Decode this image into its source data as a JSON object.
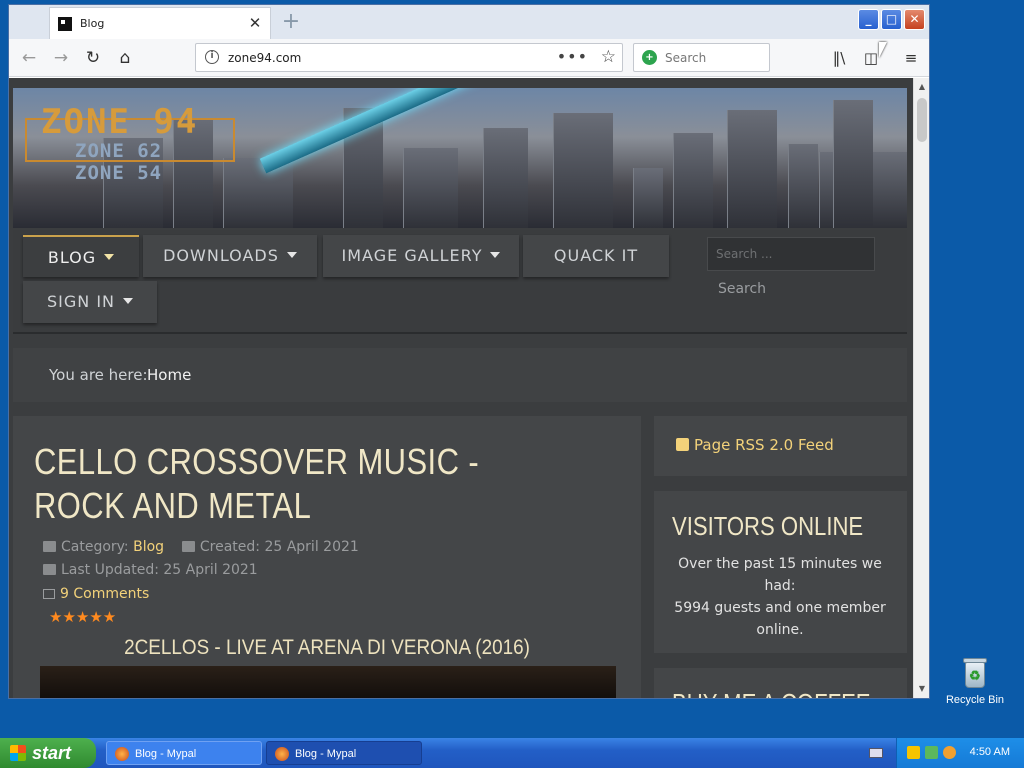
{
  "desktop": {
    "recycle_bin_label": "Recycle Bin"
  },
  "browser": {
    "tab_title": "Blog",
    "url": "zone94.com",
    "search_placeholder": "Search"
  },
  "site": {
    "logo_main": "ZONE 94",
    "logo_sub1": "ZONE 62",
    "logo_sub2": "ZONE 54",
    "menu": [
      {
        "label": "BLOG"
      },
      {
        "label": "DOWNLOADS"
      },
      {
        "label": "IMAGE GALLERY"
      },
      {
        "label": "QUACK IT"
      },
      {
        "label": "SIGN IN"
      }
    ],
    "search_placeholder": "Search ...",
    "search_button": "Search",
    "breadcrumb_label": "You are here:",
    "breadcrumb_home": "Home"
  },
  "article": {
    "title": "CELLO CROSSOVER MUSIC - ROCK AND METAL",
    "category_label": "Category:",
    "category_value": "Blog",
    "created": "Created: 25 April 2021",
    "updated": "Last Updated: 25 April 2021",
    "comments": "9 Comments",
    "rating_stars": 5,
    "subheading": "2CELLOS - LIVE AT ARENA DI VERONA (2016)"
  },
  "sidebar": {
    "rss": "Page RSS 2.0 Feed",
    "visitors_title": "VISITORS ONLINE",
    "visitors_text_1": "Over the past 15 minutes we had:",
    "visitors_text_2": "5994 guests and one member online.",
    "coffee_title": "BUY ME A COFFEE"
  },
  "taskbar": {
    "start": "start",
    "tasks": [
      {
        "label": "Blog - Mypal"
      },
      {
        "label": "Blog - Mypal"
      }
    ],
    "clock": "4:50 AM"
  },
  "colors": {
    "accent_gold": "#f3d27a",
    "title_cream": "#f0e7c6",
    "star_orange": "#ff8a1f"
  }
}
